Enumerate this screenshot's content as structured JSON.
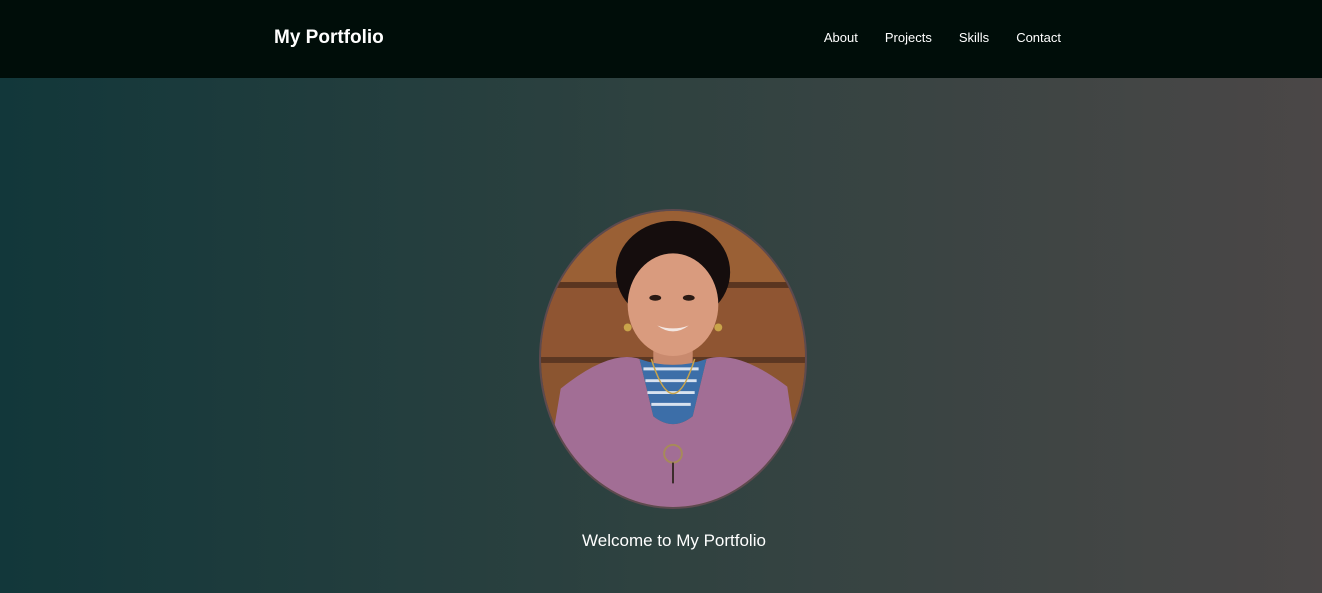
{
  "nav": {
    "brand": "My Portfolio",
    "links": [
      "About",
      "Projects",
      "Skills",
      "Contact"
    ]
  },
  "hero": {
    "avatar_icon": "portrait-photo",
    "welcome_text": "Welcome to My Portfolio"
  },
  "colors": {
    "navbar_bg": "#000d09",
    "hero_gradient_start": "#12373a",
    "hero_gradient_end": "#4b4747",
    "text": "#ffffff"
  }
}
